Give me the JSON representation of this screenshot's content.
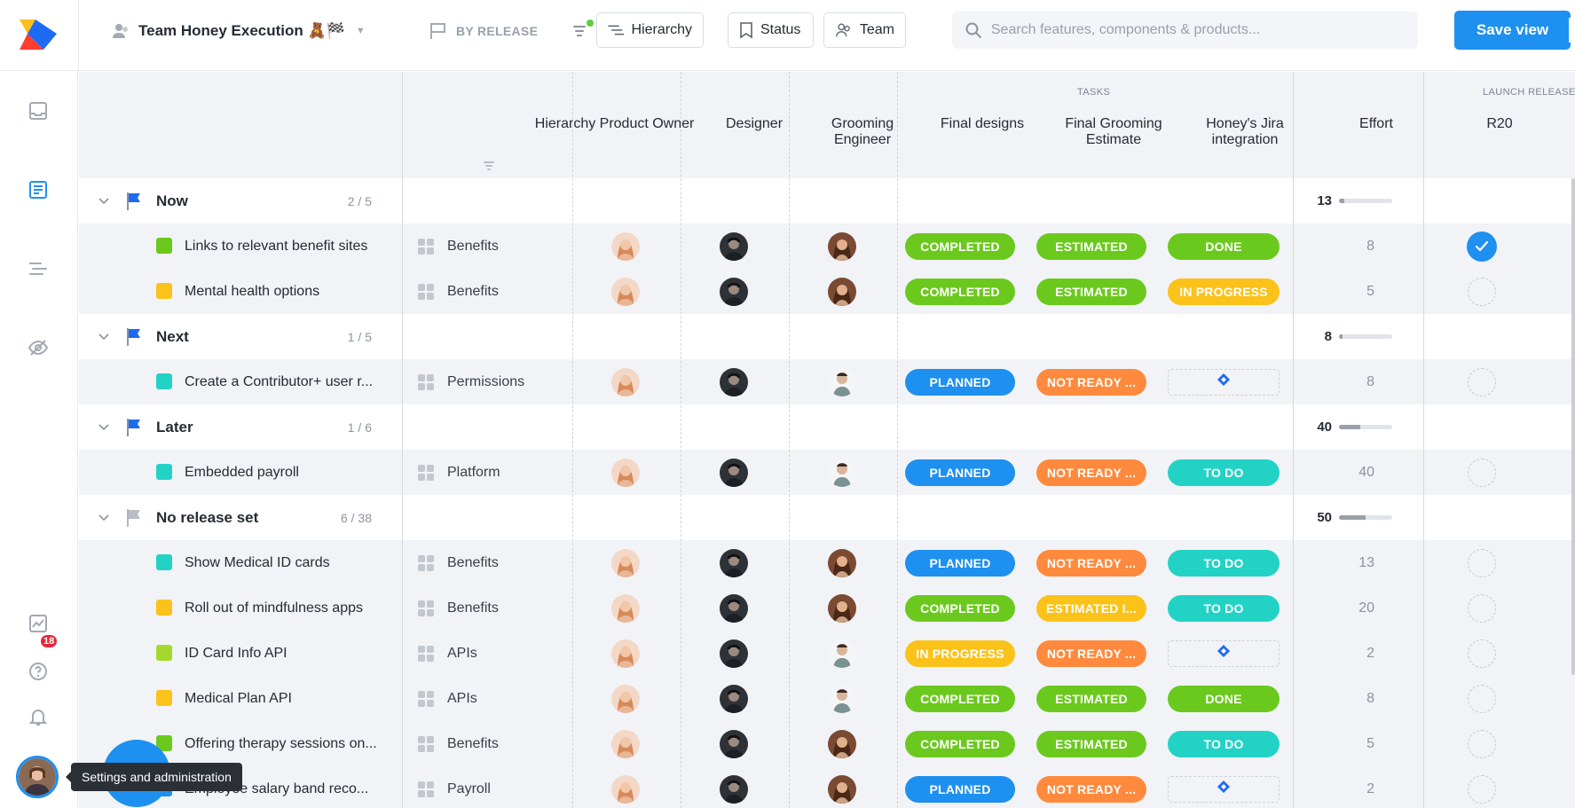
{
  "topbar": {
    "view_title": "Team Honey Execution 🧸🏁",
    "release_grouping": "BY RELEASE",
    "buttons": {
      "hierarchy": "Hierarchy",
      "status": "Status",
      "team": "Team"
    },
    "search_placeholder": "Search features, components & products...",
    "save_label": "Save view"
  },
  "rail": {
    "notification_count": "18",
    "tooltip": "Settings and administration"
  },
  "columns": {
    "group_tasks": "TASKS",
    "group_launch": "LAUNCH RELEASE",
    "hierarchy": "Hierarchy",
    "product_owner": "Product Owner",
    "designer": "Designer",
    "grooming_engineer": "Grooming Engineer",
    "final_designs": "Final designs",
    "final_grooming_estimate": "Final Grooming Estimate",
    "jira_integration": "Honey's Jira integration",
    "effort": "Effort",
    "r20": "R20"
  },
  "colors": {
    "accent": "#1e90ef",
    "completed": "#6bc91e",
    "estimated": "#6bc91e",
    "estimated_partial": "#fbc21a",
    "done": "#6bc91e",
    "in_progress": "#fbc21a",
    "planned": "#1e90ef",
    "not_ready": "#ff8a3d",
    "to_do": "#22d3c5"
  },
  "releases": [
    {
      "name": "Now",
      "count": "2 / 5",
      "effort": "13",
      "effort_fraction": 0.1,
      "flag": "blue",
      "features": [
        {
          "name": "Links to relevant benefit sites",
          "square": "#6bc91e",
          "component": "Benefits",
          "engineer": "woman",
          "final_designs": "COMPLETED",
          "grooming": "ESTIMATED",
          "jira": "DONE",
          "effort": "8",
          "r20": "checked"
        },
        {
          "name": "Mental health options",
          "square": "#fbc21a",
          "component": "Benefits",
          "engineer": "woman",
          "final_designs": "COMPLETED",
          "grooming": "ESTIMATED",
          "jira": "IN PROGRESS",
          "effort": "5",
          "r20": "empty"
        }
      ]
    },
    {
      "name": "Next",
      "count": "1 / 5",
      "effort": "8",
      "effort_fraction": 0.06,
      "flag": "blue",
      "features": [
        {
          "name": "Create a Contributor+ user r...",
          "square": "#22d3c5",
          "component": "Permissions",
          "engineer": "man",
          "final_designs": "PLANNED",
          "grooming": "NOT READY ...",
          "jira": "",
          "effort": "8",
          "r20": "empty"
        }
      ]
    },
    {
      "name": "Later",
      "count": "1 / 6",
      "effort": "40",
      "effort_fraction": 0.4,
      "flag": "blue",
      "features": [
        {
          "name": "Embedded payroll",
          "square": "#22d3c5",
          "component": "Platform",
          "engineer": "man",
          "final_designs": "PLANNED",
          "grooming": "NOT READY ...",
          "jira": "TO DO",
          "effort": "40",
          "r20": "empty"
        }
      ]
    },
    {
      "name": "No release set",
      "count": "6 / 38",
      "effort": "50",
      "effort_fraction": 0.5,
      "flag": "grey",
      "features": [
        {
          "name": "Show Medical ID cards",
          "square": "#22d3c5",
          "component": "Benefits",
          "engineer": "woman",
          "final_designs": "PLANNED",
          "grooming": "NOT READY ...",
          "jira": "TO DO",
          "effort": "13",
          "r20": "empty"
        },
        {
          "name": "Roll out of mindfulness apps",
          "square": "#fbc21a",
          "component": "Benefits",
          "engineer": "woman",
          "final_designs": "COMPLETED",
          "grooming": "ESTIMATED I...",
          "jira": "TO DO",
          "effort": "20",
          "r20": "empty"
        },
        {
          "name": "ID Card Info API",
          "square": "#a4d82c",
          "component": "APIs",
          "engineer": "man",
          "final_designs": "IN PROGRESS",
          "grooming": "NOT READY ...",
          "jira": "",
          "effort": "2",
          "r20": "empty"
        },
        {
          "name": "Medical Plan API",
          "square": "#fbc21a",
          "component": "APIs",
          "engineer": "man",
          "final_designs": "COMPLETED",
          "grooming": "ESTIMATED",
          "jira": "DONE",
          "effort": "8",
          "r20": "empty"
        },
        {
          "name": "Offering therapy sessions on...",
          "square": "#6bc91e",
          "component": "Benefits",
          "engineer": "woman",
          "final_designs": "COMPLETED",
          "grooming": "ESTIMATED",
          "jira": "TO DO",
          "effort": "5",
          "r20": "empty"
        },
        {
          "name": "Employee salary band reco...",
          "square": "#1e90ef",
          "component": "Payroll",
          "engineer": "woman",
          "final_designs": "PLANNED",
          "grooming": "NOT READY ...",
          "jira": "",
          "effort": "2",
          "r20": "empty"
        }
      ]
    }
  ]
}
